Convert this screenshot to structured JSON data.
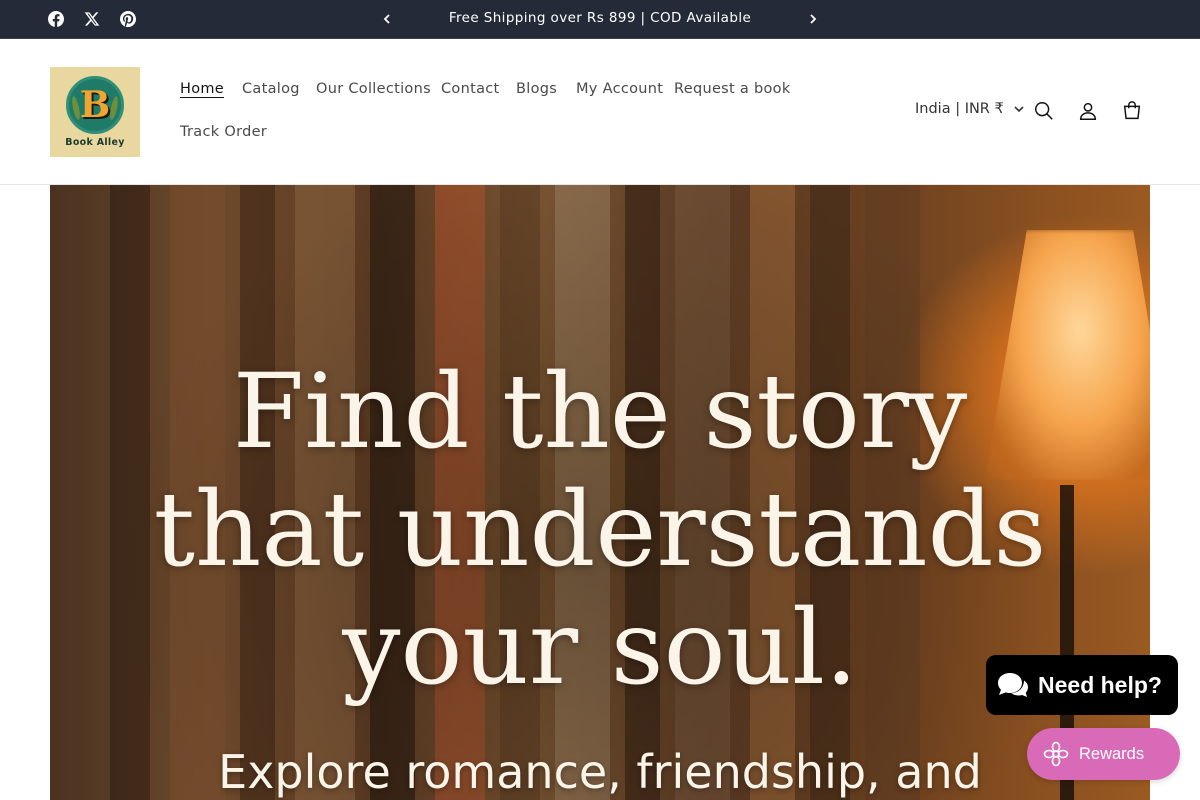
{
  "announcement": {
    "text": "Free Shipping over Rs 899 | COD Available",
    "social_icons": [
      "facebook-icon",
      "x-icon",
      "pinterest-icon"
    ]
  },
  "header": {
    "logo_letter": "B",
    "logo_text": "Book Alley",
    "nav": [
      "Home",
      "Catalog",
      "Our Collections",
      "Contact",
      "Blogs",
      "My Account",
      "Request a book",
      "Track Order"
    ],
    "active_nav": "Home",
    "locale": "India | INR ₹"
  },
  "hero": {
    "title_line1": "Find the story",
    "title_line2": "that understands",
    "title_line3": "your soul.",
    "subtitle": "Explore romance, friendship, and"
  },
  "widgets": {
    "chat_label": "Need help?",
    "rewards_label": "Rewards"
  },
  "colors": {
    "announcement_bg": "#252a38",
    "rewards_bg": "#d96ab7",
    "chat_bg": "#000000"
  }
}
